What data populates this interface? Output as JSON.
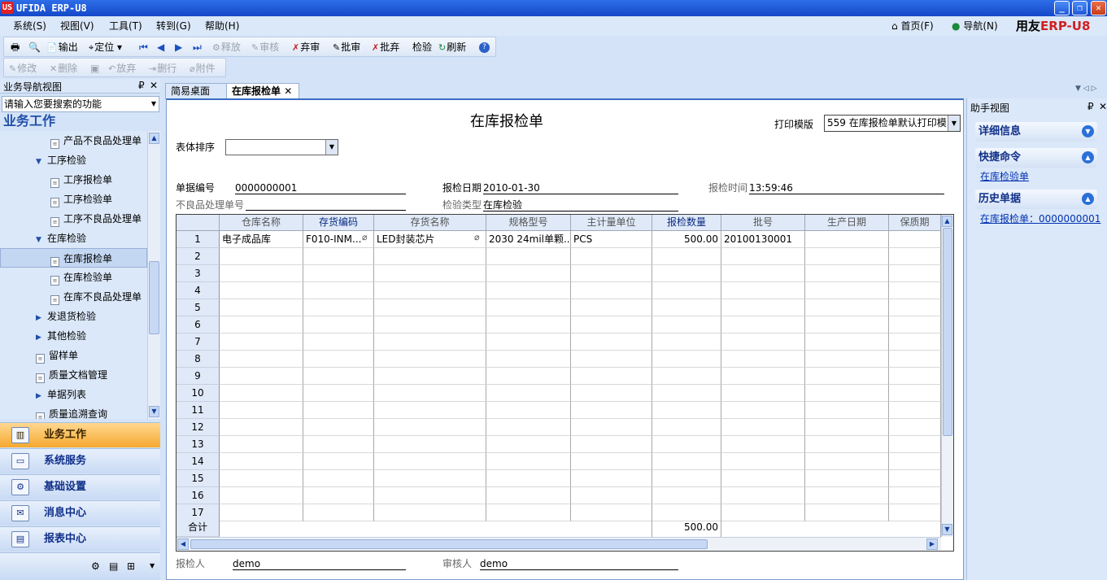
{
  "window": {
    "title": "UFIDA ERP-U8",
    "logo": "US"
  },
  "menu": {
    "items": [
      "系统(S)",
      "视图(V)",
      "工具(T)",
      "转到(G)",
      "帮助(H)"
    ]
  },
  "topright": {
    "home": "首页(F)",
    "nav": "导航(N)",
    "brand_prefix": "用友",
    "brand_erp": "ERP-",
    "brand_suffix": "U8"
  },
  "toolbar1": {
    "output": "输出",
    "locate": "定位",
    "release": "释放",
    "review": "审核",
    "abandon_review": "弃审",
    "approve": "批审",
    "abandon_approve": "批弃",
    "inspect": "检验",
    "refresh": "刷新"
  },
  "toolbar2": {
    "edit": "修改",
    "delete": "删除",
    "discard": "放弃",
    "delete_row": "删行",
    "attach": "附件"
  },
  "nav": {
    "header": "业务导航视图",
    "search_placeholder": "请输入您要搜索的功能",
    "title": "业务工作",
    "tree": [
      {
        "label": "产品不良品处理单"
      },
      {
        "label": "工序检验"
      },
      {
        "label": "工序报检单"
      },
      {
        "label": "工序检验单"
      },
      {
        "label": "工序不良品处理单"
      },
      {
        "label": "在库检验"
      },
      {
        "label": "在库报检单"
      },
      {
        "label": "在库检验单"
      },
      {
        "label": "在库不良品处理单"
      },
      {
        "label": "发退货检验"
      },
      {
        "label": "其他检验"
      },
      {
        "label": "留样单"
      },
      {
        "label": "质量文档管理"
      },
      {
        "label": "单据列表"
      },
      {
        "label": "质量追溯查询"
      }
    ],
    "big": [
      "业务工作",
      "系统服务",
      "基础设置",
      "消息中心",
      "报表中心"
    ]
  },
  "tabs": {
    "desktop": "简易桌面",
    "current": "在库报检单"
  },
  "form": {
    "title": "在库报检单",
    "print_template_label": "打印模版",
    "print_template_value": "559 在库报检单默认打印模",
    "sort_label": "表体排序",
    "doc_no_label": "单据编号",
    "doc_no": "0000000001",
    "date_label": "报检日期",
    "date": "2010-01-30",
    "time_label": "报检时间",
    "time": "13:59:46",
    "defect_no_label": "不良品处理单号",
    "defect_no": "",
    "type_label": "检验类型",
    "type": "在库检验",
    "inspector_label": "报检人",
    "inspector": "demo",
    "auditor_label": "审核人",
    "auditor": "demo"
  },
  "grid": {
    "columns": [
      "仓库名称",
      "存货编码",
      "存货名称",
      "规格型号",
      "主计量单位",
      "报检数量",
      "批号",
      "生产日期",
      "保质期"
    ],
    "row_numbers": [
      "1",
      "2",
      "3",
      "4",
      "5",
      "6",
      "7",
      "8",
      "9",
      "10",
      "11",
      "12",
      "13",
      "14",
      "15",
      "16",
      "17"
    ],
    "rows": [
      {
        "warehouse": "电子成品库",
        "code": "F010-INM...",
        "name": "LED封装芯片",
        "spec": "2030 24mil单颗...",
        "unit": "PCS",
        "qty": "500.00",
        "batch": "20100130001",
        "prod_date": "",
        "shelf": ""
      }
    ],
    "total_label": "合计",
    "total_qty": "500.00"
  },
  "helper": {
    "header": "助手视图",
    "detail": "详细信息",
    "quick": "快捷命令",
    "quick_link": "在库检验单",
    "history": "历史单据",
    "history_link": "在库报检单：0000000001"
  }
}
